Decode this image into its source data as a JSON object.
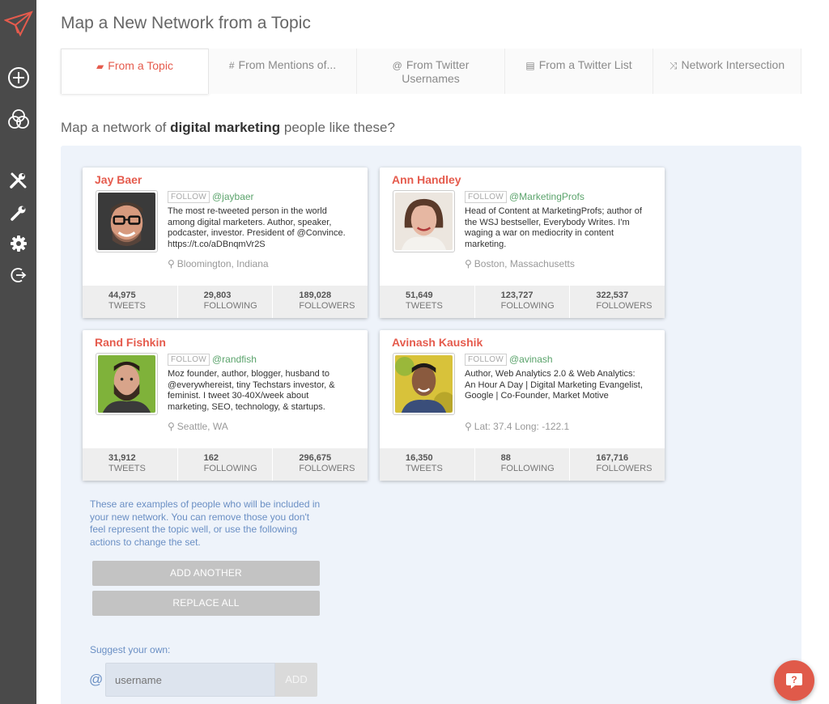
{
  "app": {
    "colors": {
      "accent": "#e55b4d",
      "sidebar": "#4a4a4a",
      "link_green": "#5aa36b",
      "help_blue": "#6a8fc4",
      "panel": "#eef3fa"
    }
  },
  "sidebar": {
    "items": [
      {
        "icon": "logo-bird-icon"
      },
      {
        "icon": "add-circle-icon"
      },
      {
        "icon": "venn-circles-icon"
      },
      {
        "icon": "tools-icon"
      },
      {
        "icon": "wrench-icon"
      },
      {
        "icon": "gear-icon"
      },
      {
        "icon": "logout-icon"
      }
    ]
  },
  "header": {
    "title": "Map a New Network from a Topic"
  },
  "tabs": [
    {
      "icon": "▰",
      "label": "From a Topic",
      "active": true
    },
    {
      "icon": "#",
      "label": "From Mentions of..."
    },
    {
      "icon": "@",
      "label": "From Twitter Usernames"
    },
    {
      "icon": "▤",
      "label": "From a Twitter List"
    },
    {
      "icon": "⤨",
      "label": "Network Intersection"
    }
  ],
  "question": {
    "prefix": "Map a network of ",
    "topic": "digital marketing",
    "suffix": " people like these?"
  },
  "people": [
    {
      "name": "Jay Baer",
      "follow": "FOLLOW",
      "handle": "@jaybaer",
      "bio": "The most re-tweeted person in the world among digital marketers. Author, speaker, podcaster, investor. President of @Convince. https://t.co/aDBnqmVr2S",
      "location": "Bloomington, Indiana",
      "tweets": "44,975",
      "following": "29,803",
      "followers": "189,028"
    },
    {
      "name": "Ann Handley",
      "follow": "FOLLOW",
      "handle": "@MarketingProfs",
      "bio": "Head of Content at MarketingProfs; author of the WSJ bestseller, Everybody Writes. I'm waging a war on mediocrity in content marketing.",
      "location": "Boston, Massachusetts",
      "tweets": "51,649",
      "following": "123,727",
      "followers": "322,537"
    },
    {
      "name": "Rand Fishkin",
      "follow": "FOLLOW",
      "handle": "@randfish",
      "bio": "Moz founder, author, blogger, husband to @everywhereist, tiny Techstars investor, & feminist. I tweet 30-40X/week about marketing, SEO, technology, & startups.",
      "location": "Seattle, WA",
      "tweets": "31,912",
      "following": "162",
      "followers": "296,675"
    },
    {
      "name": "Avinash Kaushik",
      "follow": "FOLLOW",
      "handle": "@avinash",
      "bio": "Author, Web Analytics 2.0 & Web Analytics: An Hour A Day | Digital Marketing Evangelist, Google | Co-Founder, Market Motive",
      "location": "Lat: 37.4 Long: -122.1",
      "tweets": "16,350",
      "following": "88",
      "followers": "167,716"
    }
  ],
  "stat_labels": {
    "tweets": "TWEETS",
    "following": "FOLLOWING",
    "followers": "FOLLOWERS"
  },
  "help_text": "These are examples of people who will be included in your new network. You can remove those you don't feel represent the topic well, or use the following actions to change the set.",
  "buttons": {
    "add_another": "ADD ANOTHER",
    "replace_all": "REPLACE ALL"
  },
  "suggest": {
    "label": "Suggest your own:",
    "at": "@",
    "placeholder": "username",
    "add": "ADD"
  },
  "help_bubble": {
    "icon": "question-icon",
    "glyph": "?"
  }
}
